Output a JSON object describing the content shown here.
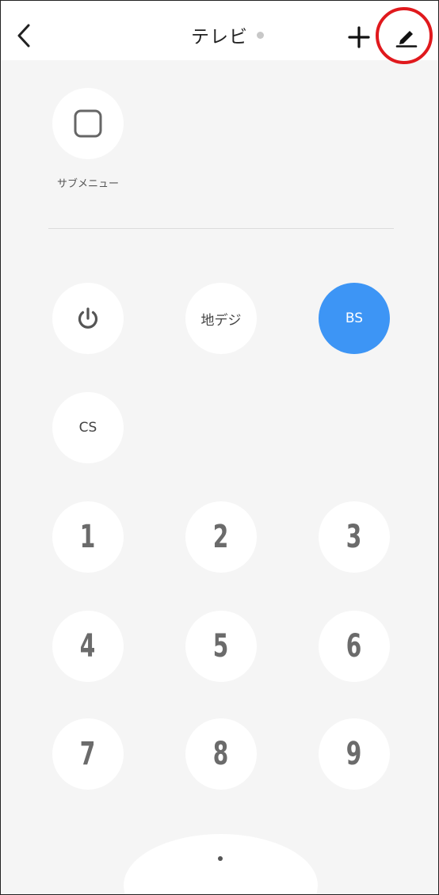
{
  "header": {
    "title": "テレビ",
    "back_icon": "chevron-left-icon",
    "add_icon": "plus-icon",
    "edit_icon": "pencil-icon",
    "highlight_color": "#e0191d"
  },
  "submenu": {
    "icon": "square-icon",
    "label": "サブメニュー"
  },
  "controls": {
    "power_icon": "power-icon",
    "terrestrial_label": "地デジ",
    "bs_label": "BS",
    "cs_label": "CS",
    "accent_color": "#3d95f5"
  },
  "numpad": {
    "keys": [
      "1",
      "2",
      "3",
      "4",
      "5",
      "6",
      "7",
      "8",
      "9"
    ]
  }
}
